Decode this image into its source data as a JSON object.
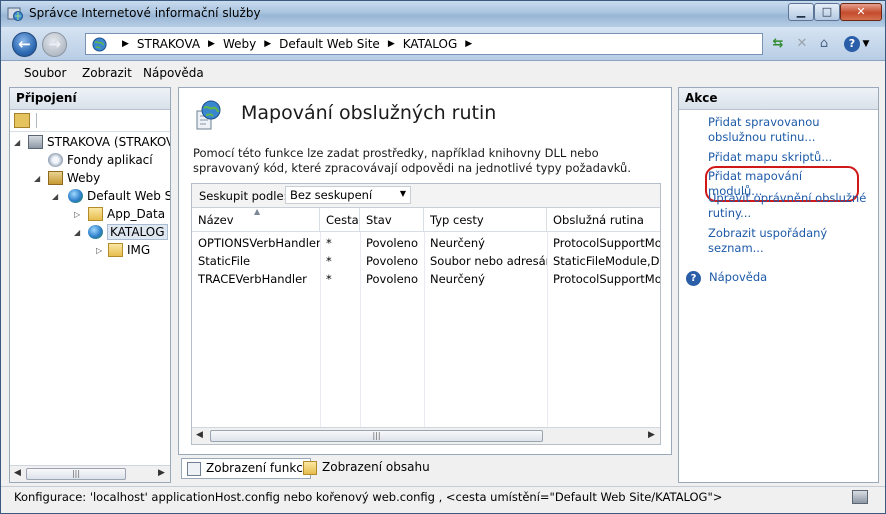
{
  "window": {
    "title": "Správce Internetové informační služby"
  },
  "address_bar": {
    "crumbs": [
      "STRAKOVA",
      "Weby",
      "Default Web Site",
      "KATALOG"
    ]
  },
  "menu": {
    "items": [
      "Soubor",
      "Zobrazit",
      "Nápověda"
    ]
  },
  "left_pane": {
    "header": "Připojení",
    "tree": [
      {
        "label": "STRAKOVA (STRAKOV",
        "icon": "server-icon"
      },
      {
        "label": "Fondy aplikací",
        "icon": "app-pool-icon"
      },
      {
        "label": "Weby",
        "icon": "sites-icon"
      },
      {
        "label": "Default Web Site",
        "icon": "globe-icon"
      },
      {
        "label": "App_Data",
        "icon": "folder-icon"
      },
      {
        "label": "KATALOG",
        "icon": "globe-icon"
      },
      {
        "label": "IMG",
        "icon": "folder-icon"
      }
    ]
  },
  "center": {
    "title": "Mapování obslužných rutin",
    "description": "Pomocí této funkce lze zadat prostředky, například knihovny DLL nebo spravovaný kód, které zpracovávají odpovědi na jednotlivé typy požadavků.",
    "group_by_label": "Seskupit podle:",
    "group_by_value": "Bez seskupení",
    "columns": [
      "Název",
      "Cesta",
      "Stav",
      "Typ cesty",
      "Obslužná rutina"
    ],
    "rows": [
      [
        "OPTIONSVerbHandler",
        "*",
        "Povoleno",
        "Neurčený",
        "ProtocolSupportMo"
      ],
      [
        "StaticFile",
        "*",
        "Povoleno",
        "Soubor nebo adresář",
        "StaticFileModule,De"
      ],
      [
        "TRACEVerbHandler",
        "*",
        "Povoleno",
        "Neurčený",
        "ProtocolSupportMo"
      ]
    ]
  },
  "view_tabs": [
    "Zobrazení funkcí",
    "Zobrazení obsahu"
  ],
  "actions": {
    "header": "Akce",
    "items": [
      "Přidat spravovanou obslužnou rutinu...",
      "Přidat mapu skriptů...",
      "Přidat mapování modulů...",
      "Upravit oprávnění obslužné rutiny...",
      "Zobrazit uspořádaný seznam..."
    ],
    "help": "Nápověda",
    "highlight_color": "#d01818"
  },
  "status_bar": {
    "text": "Konfigurace: 'localhost' applicationHost.config nebo kořenový web.config , <cesta umístění=\"Default Web Site/KATALOG\">"
  }
}
